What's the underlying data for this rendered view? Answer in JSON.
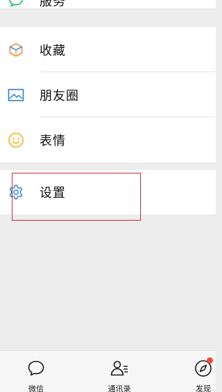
{
  "menu": {
    "top_partial": {
      "label": "服务",
      "icon": "speech-bubble-icon"
    },
    "items": [
      {
        "label": "收藏",
        "icon": "cube-icon"
      },
      {
        "label": "朋友圈",
        "icon": "picture-icon"
      },
      {
        "label": "表情",
        "icon": "smiley-icon"
      }
    ],
    "settings": {
      "label": "设置",
      "icon": "gear-icon"
    }
  },
  "tabbar": {
    "tabs": [
      {
        "label": "微信",
        "icon": "chat-bubble-icon"
      },
      {
        "label": "通讯录",
        "icon": "contacts-icon"
      },
      {
        "label": "发现",
        "icon": "compass-icon",
        "badge_dot": true
      }
    ]
  },
  "colors": {
    "accent_green": "#07c160",
    "highlight_red": "#d1262e",
    "badge_red": "#f04b45",
    "icon_blue": "#2f7fd6",
    "icon_yellow": "#f5b826"
  }
}
